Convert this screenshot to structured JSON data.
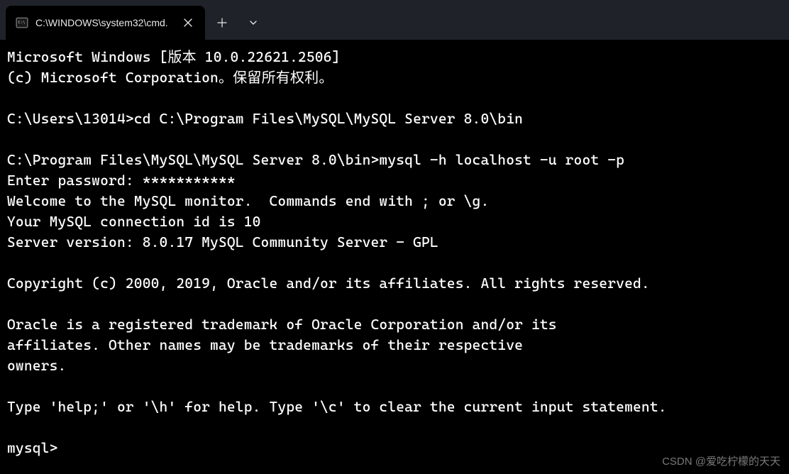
{
  "titlebar": {
    "tab_title": "C:\\WINDOWS\\system32\\cmd."
  },
  "terminal": {
    "lines": [
      "Microsoft Windows [版本 10.0.22621.2506]",
      "(c) Microsoft Corporation。保留所有权利。",
      "",
      "C:\\Users\\13014>cd C:\\Program Files\\MySQL\\MySQL Server 8.0\\bin",
      "",
      "C:\\Program Files\\MySQL\\MySQL Server 8.0\\bin>mysql -h localhost -u root -p",
      "Enter password: ***********",
      "Welcome to the MySQL monitor.  Commands end with ; or \\g.",
      "Your MySQL connection id is 10",
      "Server version: 8.0.17 MySQL Community Server - GPL",
      "",
      "Copyright (c) 2000, 2019, Oracle and/or its affiliates. All rights reserved.",
      "",
      "Oracle is a registered trademark of Oracle Corporation and/or its",
      "affiliates. Other names may be trademarks of their respective",
      "owners.",
      "",
      "Type 'help;' or '\\h' for help. Type '\\c' to clear the current input statement.",
      "",
      "mysql>"
    ]
  },
  "watermark": "CSDN @爱吃柠檬的天天"
}
